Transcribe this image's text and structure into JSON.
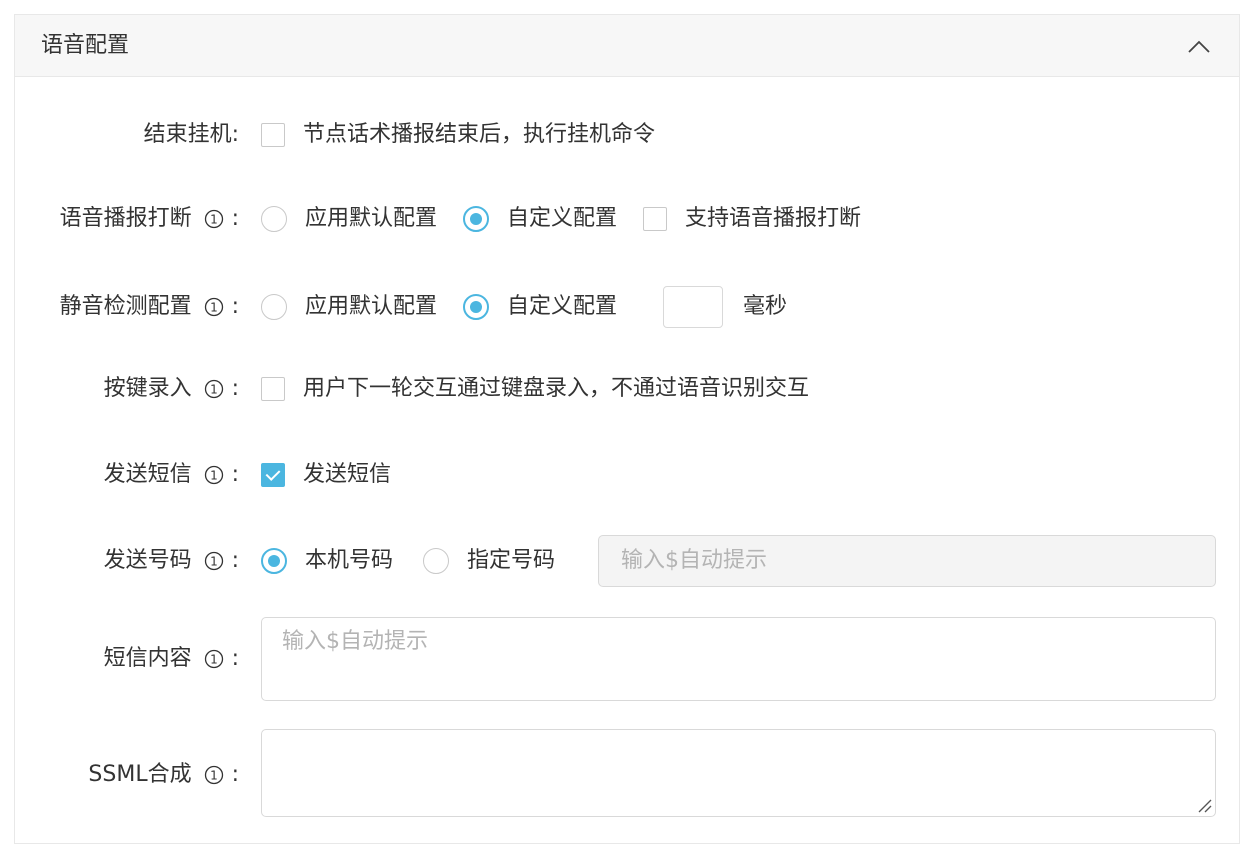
{
  "panel": {
    "title": "语音配置",
    "collapse_icon": "chevron-up-icon"
  },
  "rows": {
    "hangup": {
      "label": "结束挂机:",
      "checkbox_label": "节点话术播报结束后，执行挂机命令",
      "checked": false
    },
    "interrupt": {
      "label": "语音播报打断",
      "option_default": "应用默认配置",
      "option_custom": "自定义配置",
      "selected": "custom",
      "checkbox_label": "支持语音播报打断",
      "checked": false
    },
    "silence": {
      "label": "静音检测配置",
      "option_default": "应用默认配置",
      "option_custom": "自定义配置",
      "selected": "custom",
      "value": "",
      "unit": "毫秒"
    },
    "dtmf": {
      "label": "按键录入",
      "checkbox_label": "用户下一轮交互通过键盘录入，不通过语音识别交互",
      "checked": false
    },
    "sms": {
      "label": "发送短信",
      "checkbox_label": "发送短信",
      "checked": true
    },
    "number": {
      "label": "发送号码",
      "option_local": "本机号码",
      "option_specified": "指定号码",
      "selected": "local",
      "placeholder": "输入$自动提示"
    },
    "content": {
      "label": "短信内容",
      "placeholder": "输入$自动提示"
    },
    "ssml": {
      "label": "SSML合成"
    }
  },
  "colon": ":",
  "colors": {
    "accent": "#4bb6e0",
    "border": "#d9d9d9",
    "header_bg": "#f7f7f7"
  }
}
